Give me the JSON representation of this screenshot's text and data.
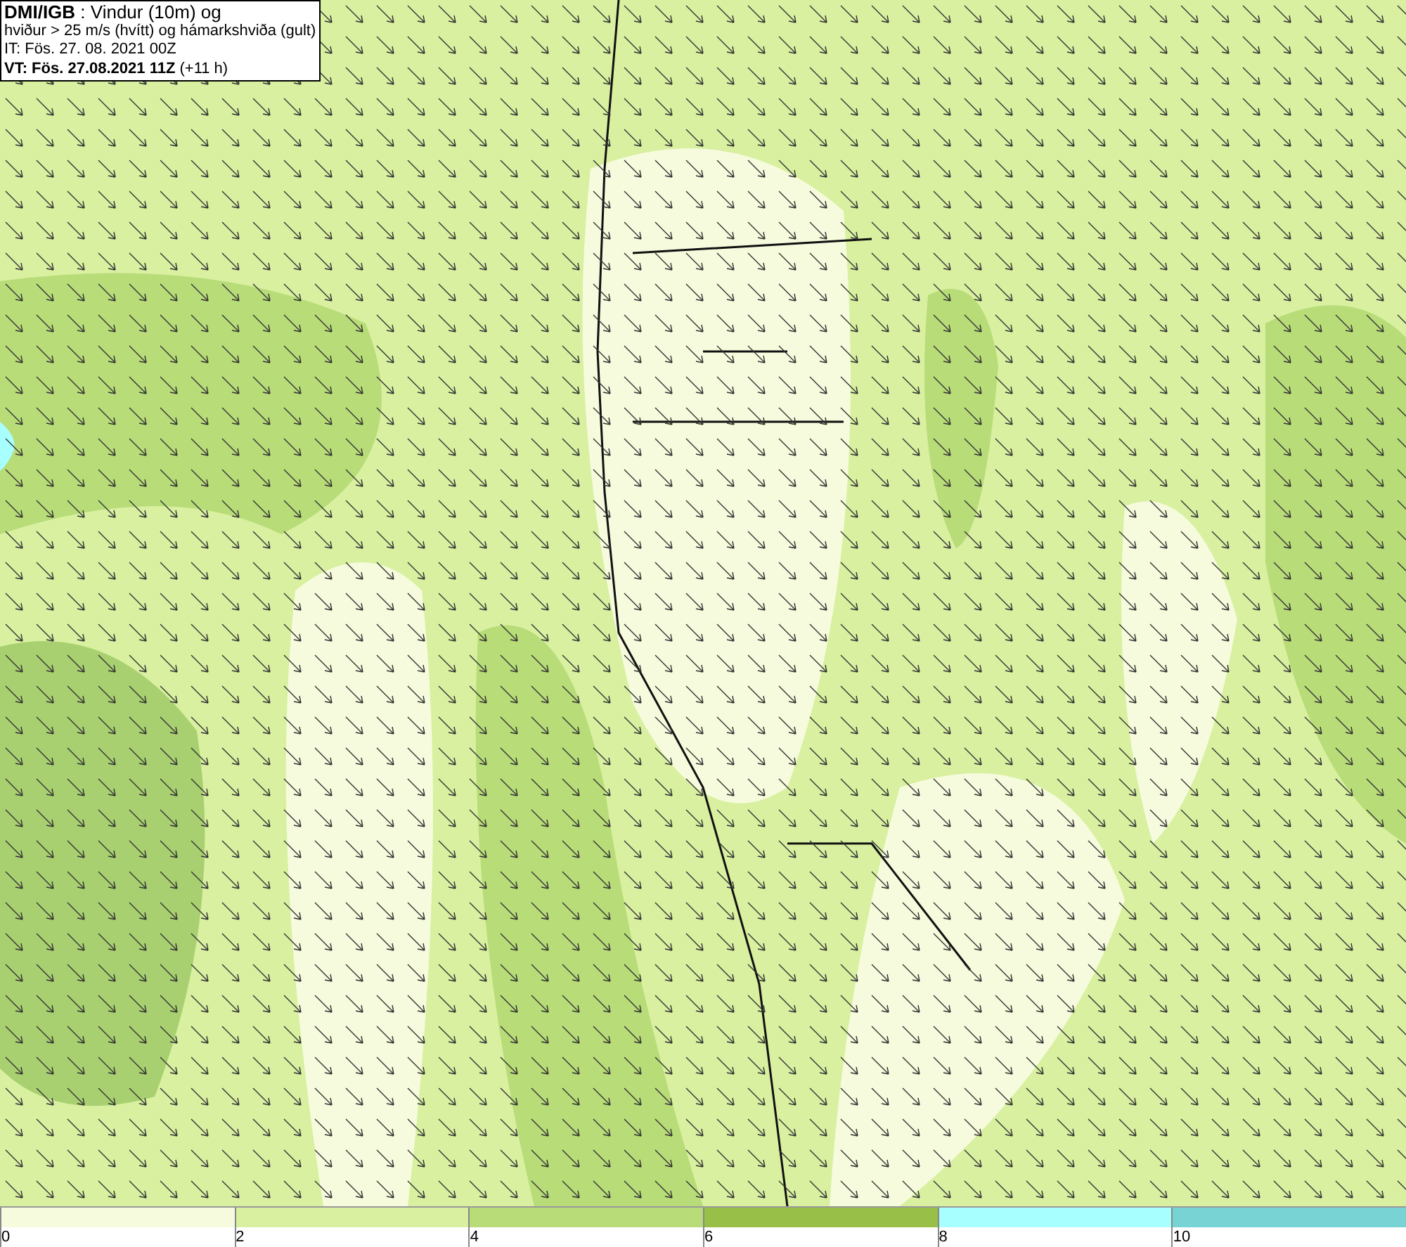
{
  "title_box": {
    "lines": [
      "**DMI/IGB** : Vindur (10m) og",
      "hviður > 25 m/s (hvítt) og hámarkshviða (gult)",
      "IT: Fös. 27. 08. 2021 00Z",
      "**VT: Fös. 27.08.2021 11Z** (+11 h)"
    ]
  },
  "legend": {
    "bins": [
      {
        "label": "0",
        "color": "#f5fbdc"
      },
      {
        "label": "2",
        "color": "#d8f0a0"
      },
      {
        "label": "4",
        "color": "#b8dc78"
      },
      {
        "label": "6",
        "color": "#98c048"
      },
      {
        "label": "8",
        "color": "#a8ffff"
      },
      {
        "label": "10",
        "color": "#78d4d4"
      }
    ]
  }
}
